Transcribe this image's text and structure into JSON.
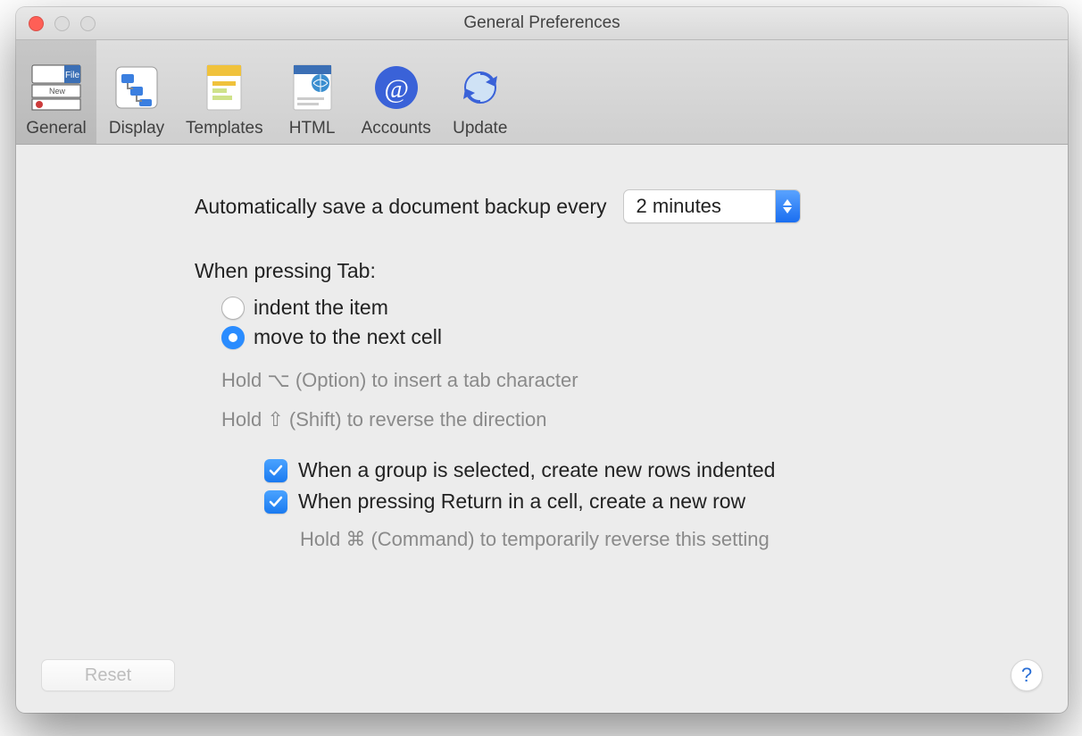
{
  "window": {
    "title": "General Preferences"
  },
  "toolbar": {
    "items": [
      {
        "label": "General"
      },
      {
        "label": "Display"
      },
      {
        "label": "Templates"
      },
      {
        "label": "HTML"
      },
      {
        "label": "Accounts"
      },
      {
        "label": "Update"
      }
    ]
  },
  "backup": {
    "label": "Automatically save a document backup every",
    "value": "2 minutes"
  },
  "tab_section": {
    "heading": "When pressing Tab:",
    "options": [
      {
        "label": "indent the item",
        "selected": false
      },
      {
        "label": "move to the next cell",
        "selected": true
      }
    ],
    "hint_option": "Hold ⌥ (Option) to insert a tab character",
    "hint_shift": "Hold ⇧ (Shift) to reverse the direction"
  },
  "checks": {
    "group_indent": "When a group is selected, create new rows indented",
    "return_newrow": "When pressing Return in a cell, create a new row",
    "command_hint": "Hold ⌘ (Command) to temporarily reverse this setting"
  },
  "footer": {
    "reset": "Reset",
    "help": "?"
  }
}
